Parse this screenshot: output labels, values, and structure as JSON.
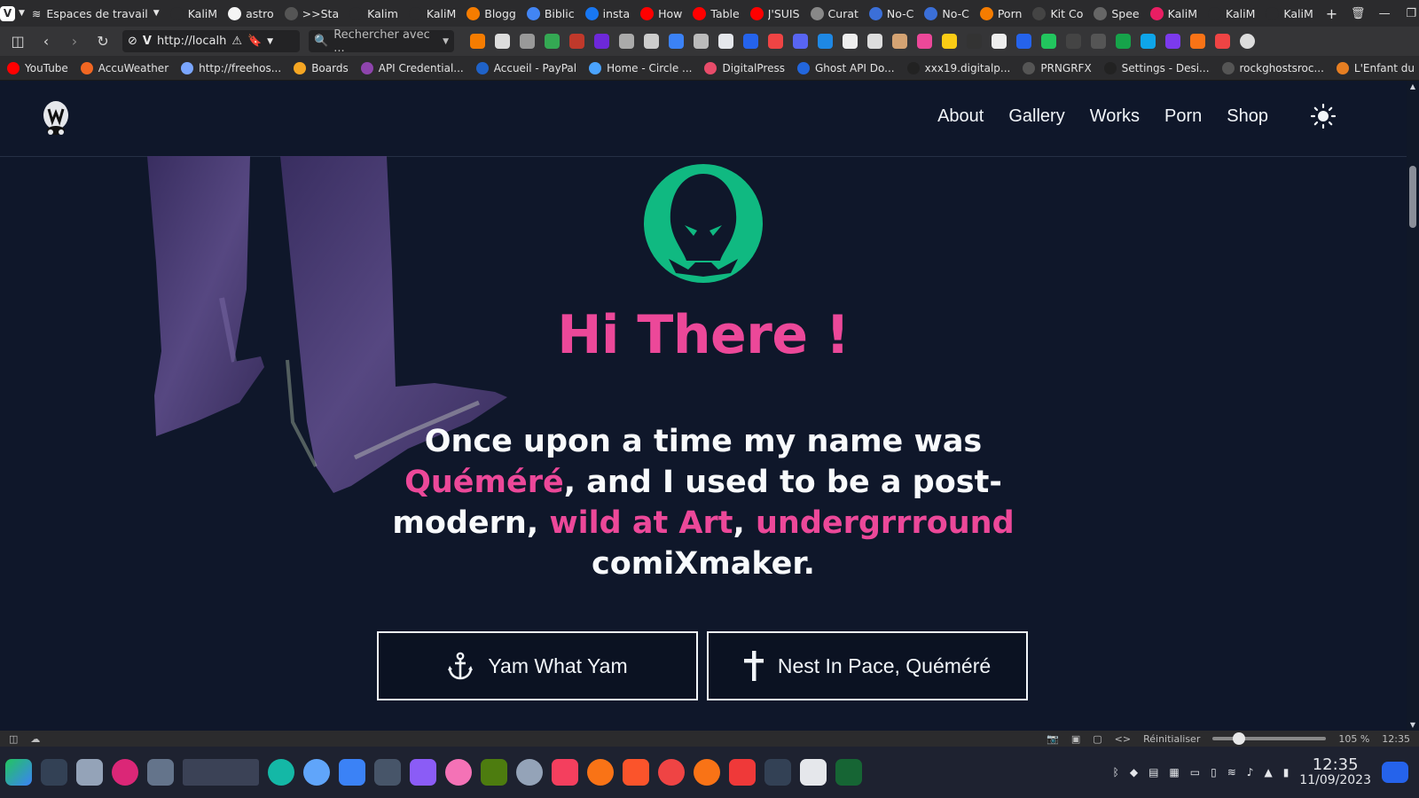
{
  "browser": {
    "workspace_label": "Espaces de travail",
    "tabs": [
      {
        "label": "KaliM",
        "color": "#2b2b2d"
      },
      {
        "label": "astro",
        "color": "#f5f5f5"
      },
      {
        "label": ">>Sta",
        "color": "#555555"
      },
      {
        "label": "Kalim",
        "color": "#2b2b2d"
      },
      {
        "label": "KaliM",
        "color": "#2b2b2d"
      },
      {
        "label": "Blogg",
        "color": "#f57c00"
      },
      {
        "label": "Biblic",
        "color": "#4285f4"
      },
      {
        "label": "insta",
        "color": "#1877f2"
      },
      {
        "label": "How",
        "color": "#ff0000"
      },
      {
        "label": "Table",
        "color": "#ff0000"
      },
      {
        "label": "J'SUIS",
        "color": "#ff0000"
      },
      {
        "label": "Curat",
        "color": "#888888"
      },
      {
        "label": "No-C",
        "color": "#3b6fd8"
      },
      {
        "label": "No-C",
        "color": "#3b6fd8"
      },
      {
        "label": "Porn",
        "color": "#f57c00"
      },
      {
        "label": "Kit Co",
        "color": "#444444"
      },
      {
        "label": "Spee",
        "color": "#666666"
      },
      {
        "label": "KaliM",
        "color": "#e91e63"
      },
      {
        "label": "KaliM",
        "color": "#2b2b2d"
      },
      {
        "label": "KaliM",
        "color": "#2b2b2d"
      }
    ],
    "url": "http://localh",
    "search_placeholder": "Rechercher avec ...",
    "bookmarks": [
      {
        "label": "YouTube",
        "color": "#ff0000"
      },
      {
        "label": "AccuWeather",
        "color": "#f26722"
      },
      {
        "label": "http://freehos...",
        "color": "#7aa6ff"
      },
      {
        "label": "Boards",
        "color": "#f5a623"
      },
      {
        "label": "API Credential...",
        "color": "#8e44ad"
      },
      {
        "label": "Accueil - PayPal",
        "color": "#1f62c8"
      },
      {
        "label": "Home - Circle ...",
        "color": "#4aa3ff"
      },
      {
        "label": "DigitalPress",
        "color": "#e84c6a"
      },
      {
        "label": "Ghost API Do...",
        "color": "#2266dd"
      },
      {
        "label": "xxx19.digitalp...",
        "color": "#222222"
      },
      {
        "label": "PRNGRFX",
        "color": "#555555"
      },
      {
        "label": "Settings - Desi...",
        "color": "#222222"
      },
      {
        "label": "rockghostsroc...",
        "color": "#555555"
      },
      {
        "label": "L'Enfant du R...",
        "color": "#e67e22"
      }
    ],
    "status": {
      "reset_label": "Réinitialiser",
      "zoom": "105 %",
      "zoom_fraction": 0.2,
      "time": "12:35"
    }
  },
  "site": {
    "nav": [
      "About",
      "Gallery",
      "Works",
      "Porn",
      "Shop"
    ],
    "hero_title": "Hi There !",
    "hero_text": {
      "part1": "Once upon a time my name was ",
      "name": "Quéméré",
      "part2": ", and I used to be a post-modern, ",
      "wild": "wild at Art",
      "part3": ", ",
      "under": "undergrrround",
      "part4": " comiXmaker."
    },
    "buttons": [
      {
        "label": "Yam What Yam",
        "icon": "anchor-icon"
      },
      {
        "label": "Nest In Pace, Quéméré",
        "icon": "cross-icon"
      }
    ],
    "colors": {
      "background": "#0f172a",
      "accent": "#ec4899",
      "logo_green": "#10b981"
    }
  },
  "taskbar": {
    "time": "12:35",
    "date": "11/09/2023"
  }
}
